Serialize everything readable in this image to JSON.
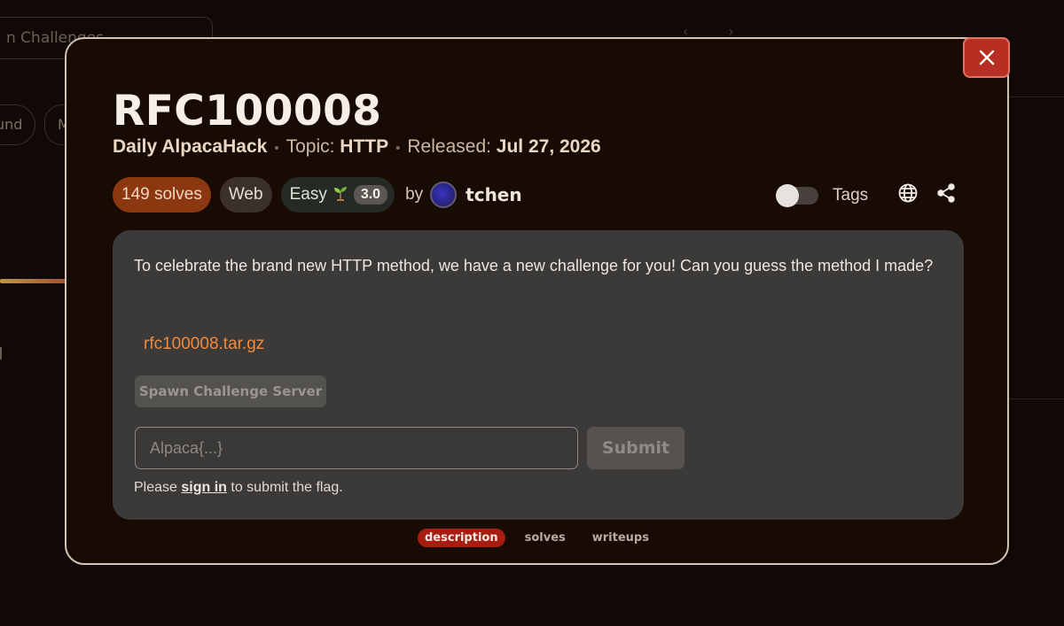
{
  "background": {
    "search_placeholder": "n Challenges",
    "pill_1": "und",
    "pill_2": "M"
  },
  "challenge": {
    "title": "RFC100008",
    "event": "Daily AlpacaHack",
    "topic_label": "Topic:",
    "topic": "HTTP",
    "released_label": "Released:",
    "released_date": "Jul 27, 2026",
    "solves": "149 solves",
    "category": "Web",
    "difficulty": "Easy",
    "difficulty_icon": "sprout-icon",
    "difficulty_score": "3.0",
    "by_label": "by",
    "author": "tchen",
    "tags_label": "Tags",
    "tags_toggle_on": false,
    "description": "To celebrate the brand new HTTP method, we have a new challenge for you! Can you guess the method I made?",
    "attachment": "rfc100008.tar.gz",
    "spawn_label": "Spawn Challenge Server",
    "flag_placeholder": "Alpaca{...}",
    "submit_label": "Submit",
    "signin_prefix": "Please",
    "signin_link": "sign in",
    "signin_suffix": "to submit the flag."
  },
  "tabs": [
    {
      "label": "description",
      "active": true
    },
    {
      "label": "solves",
      "active": false
    },
    {
      "label": "writeups",
      "active": false
    }
  ],
  "colors": {
    "accent": "#a61e12",
    "solves_badge": "#8b3810",
    "link": "#f08a3c",
    "close": "#b62f22"
  }
}
